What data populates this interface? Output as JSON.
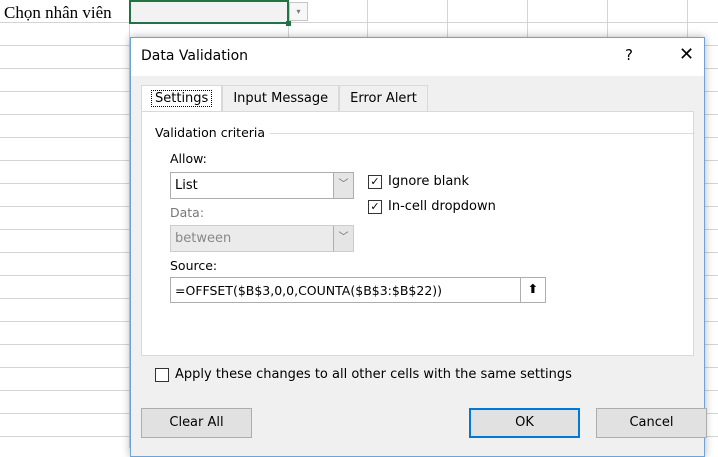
{
  "sheet": {
    "cell_label": "Chọn nhân viên",
    "dropdown_arrow": "▾"
  },
  "dialog": {
    "title": "Data Validation",
    "help": "?",
    "close": "✕",
    "tabs": [
      {
        "label": "Settings"
      },
      {
        "label": "Input Message"
      },
      {
        "label": "Error Alert"
      }
    ],
    "group_label": "Validation criteria",
    "allow_label": "Allow:",
    "allow_value": "List",
    "data_label": "Data:",
    "data_value": "between",
    "ignore_blank": {
      "label": "Ignore blank",
      "checked": true
    },
    "in_cell_dropdown": {
      "label": "In-cell dropdown",
      "checked": true
    },
    "source_label": "Source:",
    "source_value": "=OFFSET($B$3,0,0,COUNTA($B$3:$B$22))",
    "apply_all": {
      "label": "Apply these changes to all other cells with the same settings",
      "checked": false
    },
    "buttons": {
      "clear_all": "Clear All",
      "ok": "OK",
      "cancel": "Cancel"
    }
  }
}
